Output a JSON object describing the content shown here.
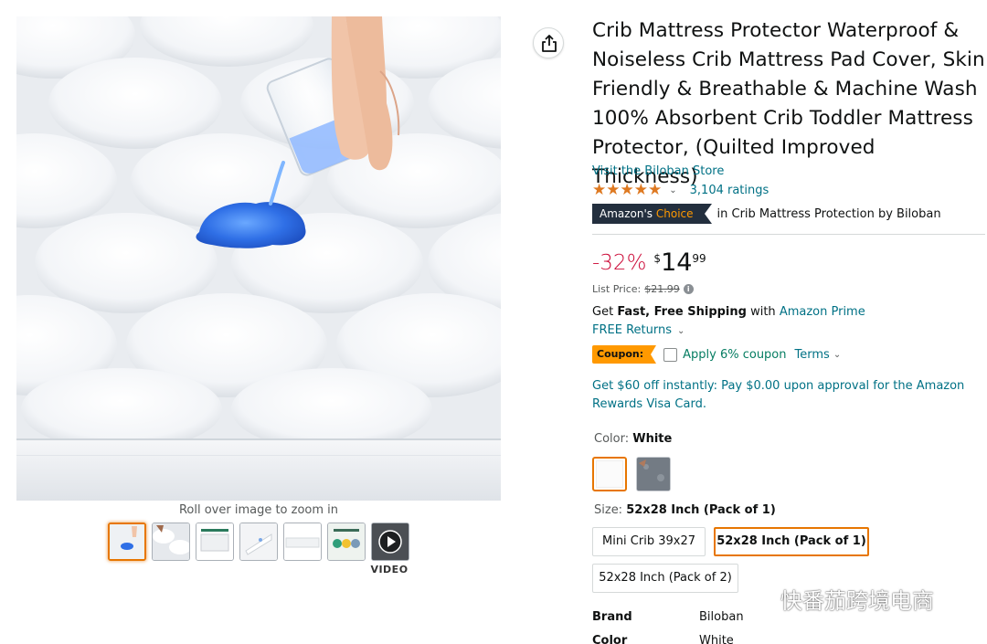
{
  "gallery": {
    "zoom_hint": "Roll over image to zoom in",
    "video_label": "VIDEO",
    "thumbnails": [
      "water-pour",
      "quilt-closeup",
      "size-chart",
      "water-drop",
      "side-view",
      "feature-icons",
      "video"
    ]
  },
  "product": {
    "title": "Crib Mattress Protector Waterproof & Noiseless Crib Mattress Pad Cover, Skin Friendly & Breathable & Machine Wash 100% Absorbent Crib Toddler Mattress Protector, (Quilted Improved Thickness)",
    "store_link": "Visit the Biloban Store",
    "rating_stars": 4.5,
    "ratings_count": "3,104 ratings",
    "choice_badge_prefix": "Amazon's",
    "choice_badge_word": "Choice",
    "choice_category": "in Crib Mattress Protection by Biloban"
  },
  "pricing": {
    "discount": "-32%",
    "currency_symbol": "$",
    "price_whole": "14",
    "price_fraction": "99",
    "list_price_label": "List Price:",
    "list_price_value": "$21.99"
  },
  "shipping": {
    "prefix": "Get ",
    "bold": "Fast, Free Shipping",
    "middle": " with ",
    "link": "Amazon Prime",
    "returns": "FREE Returns"
  },
  "coupon": {
    "badge": "Coupon:",
    "text": "Apply 6% coupon",
    "terms": "Terms"
  },
  "credit_offer": "Get $60 off instantly: Pay $0.00 upon approval for the Amazon Rewards Visa Card.",
  "color": {
    "label": "Color:",
    "selected": "White"
  },
  "size": {
    "label": "Size:",
    "selected": "52x28 Inch (Pack of 1)",
    "options": [
      "Mini Crib 39x27",
      "52x28 Inch (Pack of 1)",
      "52x28 Inch (Pack of 2)"
    ]
  },
  "details": [
    {
      "key": "Brand",
      "value": "Biloban"
    },
    {
      "key": "Color",
      "value": "White"
    }
  ],
  "watermark": "快番茄跨境电商",
  "colors": {
    "link": "#007185",
    "star": "#de7921",
    "deal_red": "#cc0c39",
    "selected_orange": "#e77600",
    "coupon_orange": "#ff9900",
    "coupon_green": "#067d62",
    "badge_navy": "#232f3e"
  }
}
